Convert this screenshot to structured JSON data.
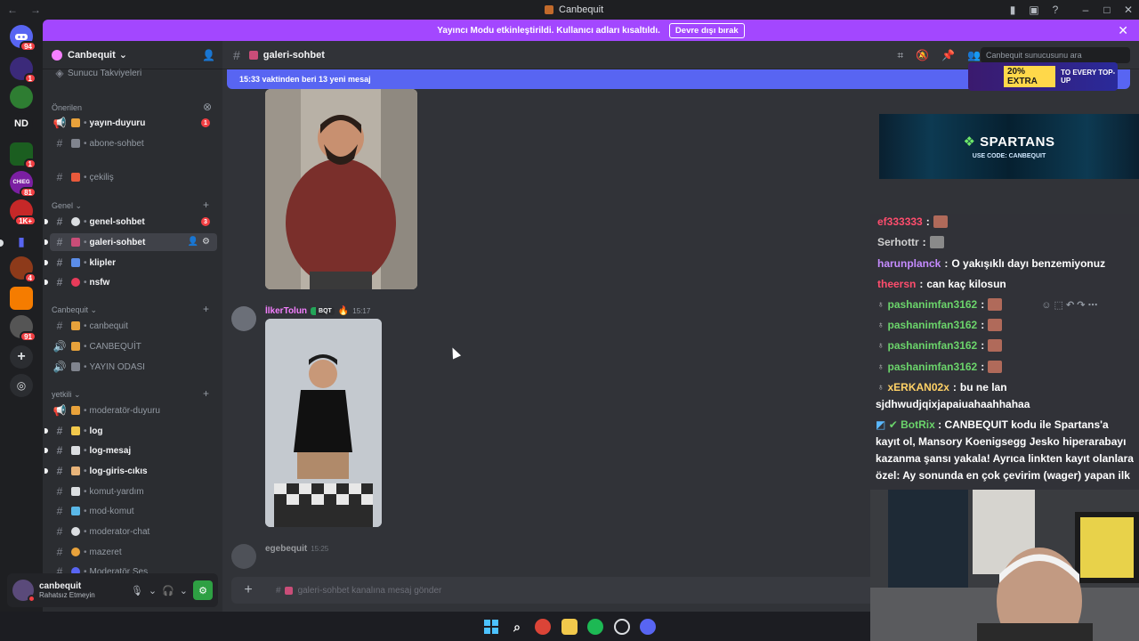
{
  "window": {
    "title": "Canbequit"
  },
  "notice": {
    "text": "Yayıncı Modu etkinleştirildi. Kullanıcı adları kısaltıldı.",
    "button": "Devre dışı bırak"
  },
  "guilds": [
    {
      "label": "",
      "badge": "94",
      "color": "#5865f2"
    },
    {
      "label": "",
      "badge": "1",
      "color": "#3b2a7a"
    },
    {
      "label": "",
      "badge": "",
      "color": "#2e7d32"
    },
    {
      "label": "ND",
      "badge": "",
      "color": "#1e1f22"
    },
    {
      "label": "",
      "badge": "1",
      "color": "#1b5e20"
    },
    {
      "label": "CHIEG",
      "badge": "81",
      "color": "#7b1fa2"
    },
    {
      "label": "",
      "badge": "1K+",
      "color": "#c62828"
    },
    {
      "label": "",
      "badge": "",
      "color": "#5865f2"
    },
    {
      "label": "",
      "badge": "4",
      "color": "#8d3a1a"
    },
    {
      "label": "",
      "badge": "",
      "color": "#f57c00"
    },
    {
      "label": "",
      "badge": "91",
      "color": "#555"
    }
  ],
  "server": {
    "name": "Canbequit",
    "truncated_top": "Sunucu Takviyeleri",
    "categories": {
      "onerilen": "Önerilen",
      "genel": "Genel",
      "canbequit": "Canbequit",
      "yetkili": "yetkili"
    },
    "channels": [
      {
        "name": "yayın-duyuru",
        "badge": "1",
        "unread": true
      },
      {
        "name": "abone-sohbet"
      },
      {
        "name": "çekiliş"
      },
      {
        "name": "genel-sohbet",
        "badge": "3",
        "unread": true
      },
      {
        "name": "galeri-sohbet",
        "active": true
      },
      {
        "name": "klipler",
        "unread": true
      },
      {
        "name": "nsfw",
        "unread": true
      },
      {
        "name": "canbequit"
      },
      {
        "name": "CANBEQUİT"
      },
      {
        "name": "YAYIN ODASI"
      },
      {
        "name": "moderatör-duyuru"
      },
      {
        "name": "log",
        "unread": true
      },
      {
        "name": "log-mesaj",
        "unread": true
      },
      {
        "name": "log-giris-cıkıs",
        "unread": true
      },
      {
        "name": "komut-yardım"
      },
      {
        "name": "mod-komut"
      },
      {
        "name": "moderator-chat"
      },
      {
        "name": "mazeret"
      },
      {
        "name": "Moderatör Ses"
      }
    ]
  },
  "user": {
    "name": "canbequit",
    "status": "Rahatsız Etmeyin"
  },
  "channel": {
    "name": "galeri-sohbet",
    "search_placeholder": "Canbequit sunucusunu ara",
    "new_messages": "15:33 vaktinden beri 13 yeni mesaj",
    "composer_placeholder": "galeri-sohbet kanalına mesaj gönder"
  },
  "messages": [
    {
      "author": "İlkerTolun",
      "tag": "BQT",
      "time": "15:17"
    },
    {
      "author": "egebequit",
      "time": "15:25"
    }
  ],
  "overlay": {
    "sponsor": "SPARTANS",
    "sponsor_code": "USE CODE: CANBEQUIT",
    "ad_percent": "20% EXTRA",
    "ad_text": "TO EVERY TOP-UP",
    "chat": [
      {
        "user": "ef333333",
        "color": "#ff4d6d",
        "text": ""
      },
      {
        "user": "Serhottr",
        "color": "#d0d0d0",
        "text": ""
      },
      {
        "user": "harunplanck",
        "color": "#c58bff",
        "text": "O yakışıklı dayı benzemiyonuz"
      },
      {
        "user": "theersn",
        "color": "#ff4d6d",
        "text": "can kaç kilosun"
      },
      {
        "user": "pashanimfan3162",
        "color": "#6bd46b",
        "text": ""
      },
      {
        "user": "pashanimfan3162",
        "color": "#6bd46b",
        "text": ""
      },
      {
        "user": "pashanimfan3162",
        "color": "#6bd46b",
        "text": ""
      },
      {
        "user": "pashanimfan3162",
        "color": "#6bd46b",
        "text": ""
      },
      {
        "user": "xERKAN02x",
        "color": "#ffd166",
        "text": "bu ne lan"
      }
    ],
    "chat_wrap": "sjdhwudjqixjapaiuahaahhahaa",
    "bot_user": "BotRix",
    "bot_text": "CANBEQUIT kodu ile Spartans'a kayıt ol, Mansory Koenigsegg Jesko hiperarabayı kazanma şansı yakala! Ayrıca linkten kayıt olanlara özel: Ay sonunda en çok çevirim (wager) yapan ilk"
  }
}
